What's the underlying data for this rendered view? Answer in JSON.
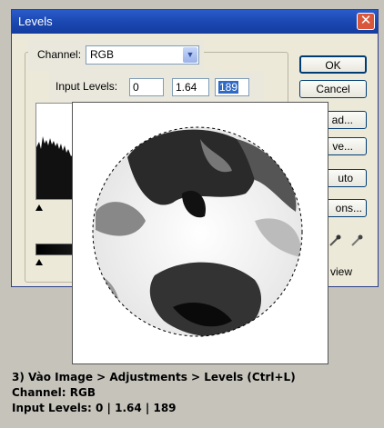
{
  "dialog": {
    "title": "Levels",
    "channel_label": "Channel:",
    "channel_value": "RGB",
    "input_levels_label": "Input Levels:",
    "input_levels": [
      "0",
      "1.64",
      "189"
    ]
  },
  "buttons": {
    "ok": "OK",
    "cancel": "Cancel",
    "load": "ad...",
    "save": "ve...",
    "auto": "uto",
    "options": "ons..."
  },
  "preview_label": "view",
  "caption": {
    "line1": "3) Vào Image > Adjustments > Levels (Ctrl+L)",
    "line2": "Channel: RGB",
    "line3": "Input Levels: 0 | 1.64 | 189"
  }
}
